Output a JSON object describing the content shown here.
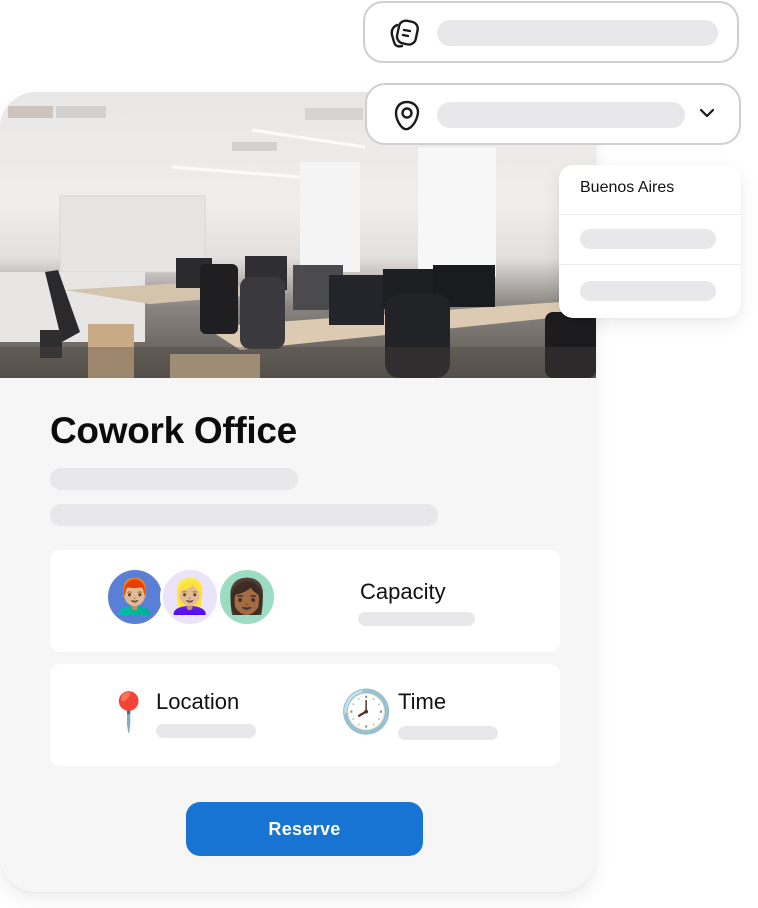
{
  "card": {
    "title": "Cowork Office",
    "image_alt": "Open-plan office with desks, monitors and chairs",
    "capacity": {
      "label": "Capacity",
      "avatars": [
        {
          "name": "man-red-hair-avatar",
          "emoji": "👨🏼‍🦰",
          "bg": "#5a7fd6"
        },
        {
          "name": "woman-blonde-avatar",
          "emoji": "👱🏼‍♀️",
          "bg": "#ebe4f8"
        },
        {
          "name": "woman-dark-hair-avatar",
          "emoji": "👩🏾",
          "bg": "#9bdcc2"
        }
      ]
    },
    "location": {
      "label": "Location",
      "icon": "📍"
    },
    "time": {
      "label": "Time",
      "icon": "🕗"
    },
    "reserve_label": "Reserve"
  },
  "search_fields": [
    {
      "icon": "notes-icon"
    },
    {
      "icon": "location-pin-icon",
      "has_dropdown": true
    }
  ],
  "dropdown": {
    "items": [
      {
        "label": "Buenos Aires"
      }
    ]
  },
  "colors": {
    "accent": "#1874d2",
    "skeleton": "#e8e8ea",
    "card_bg": "#f6f6f7"
  }
}
